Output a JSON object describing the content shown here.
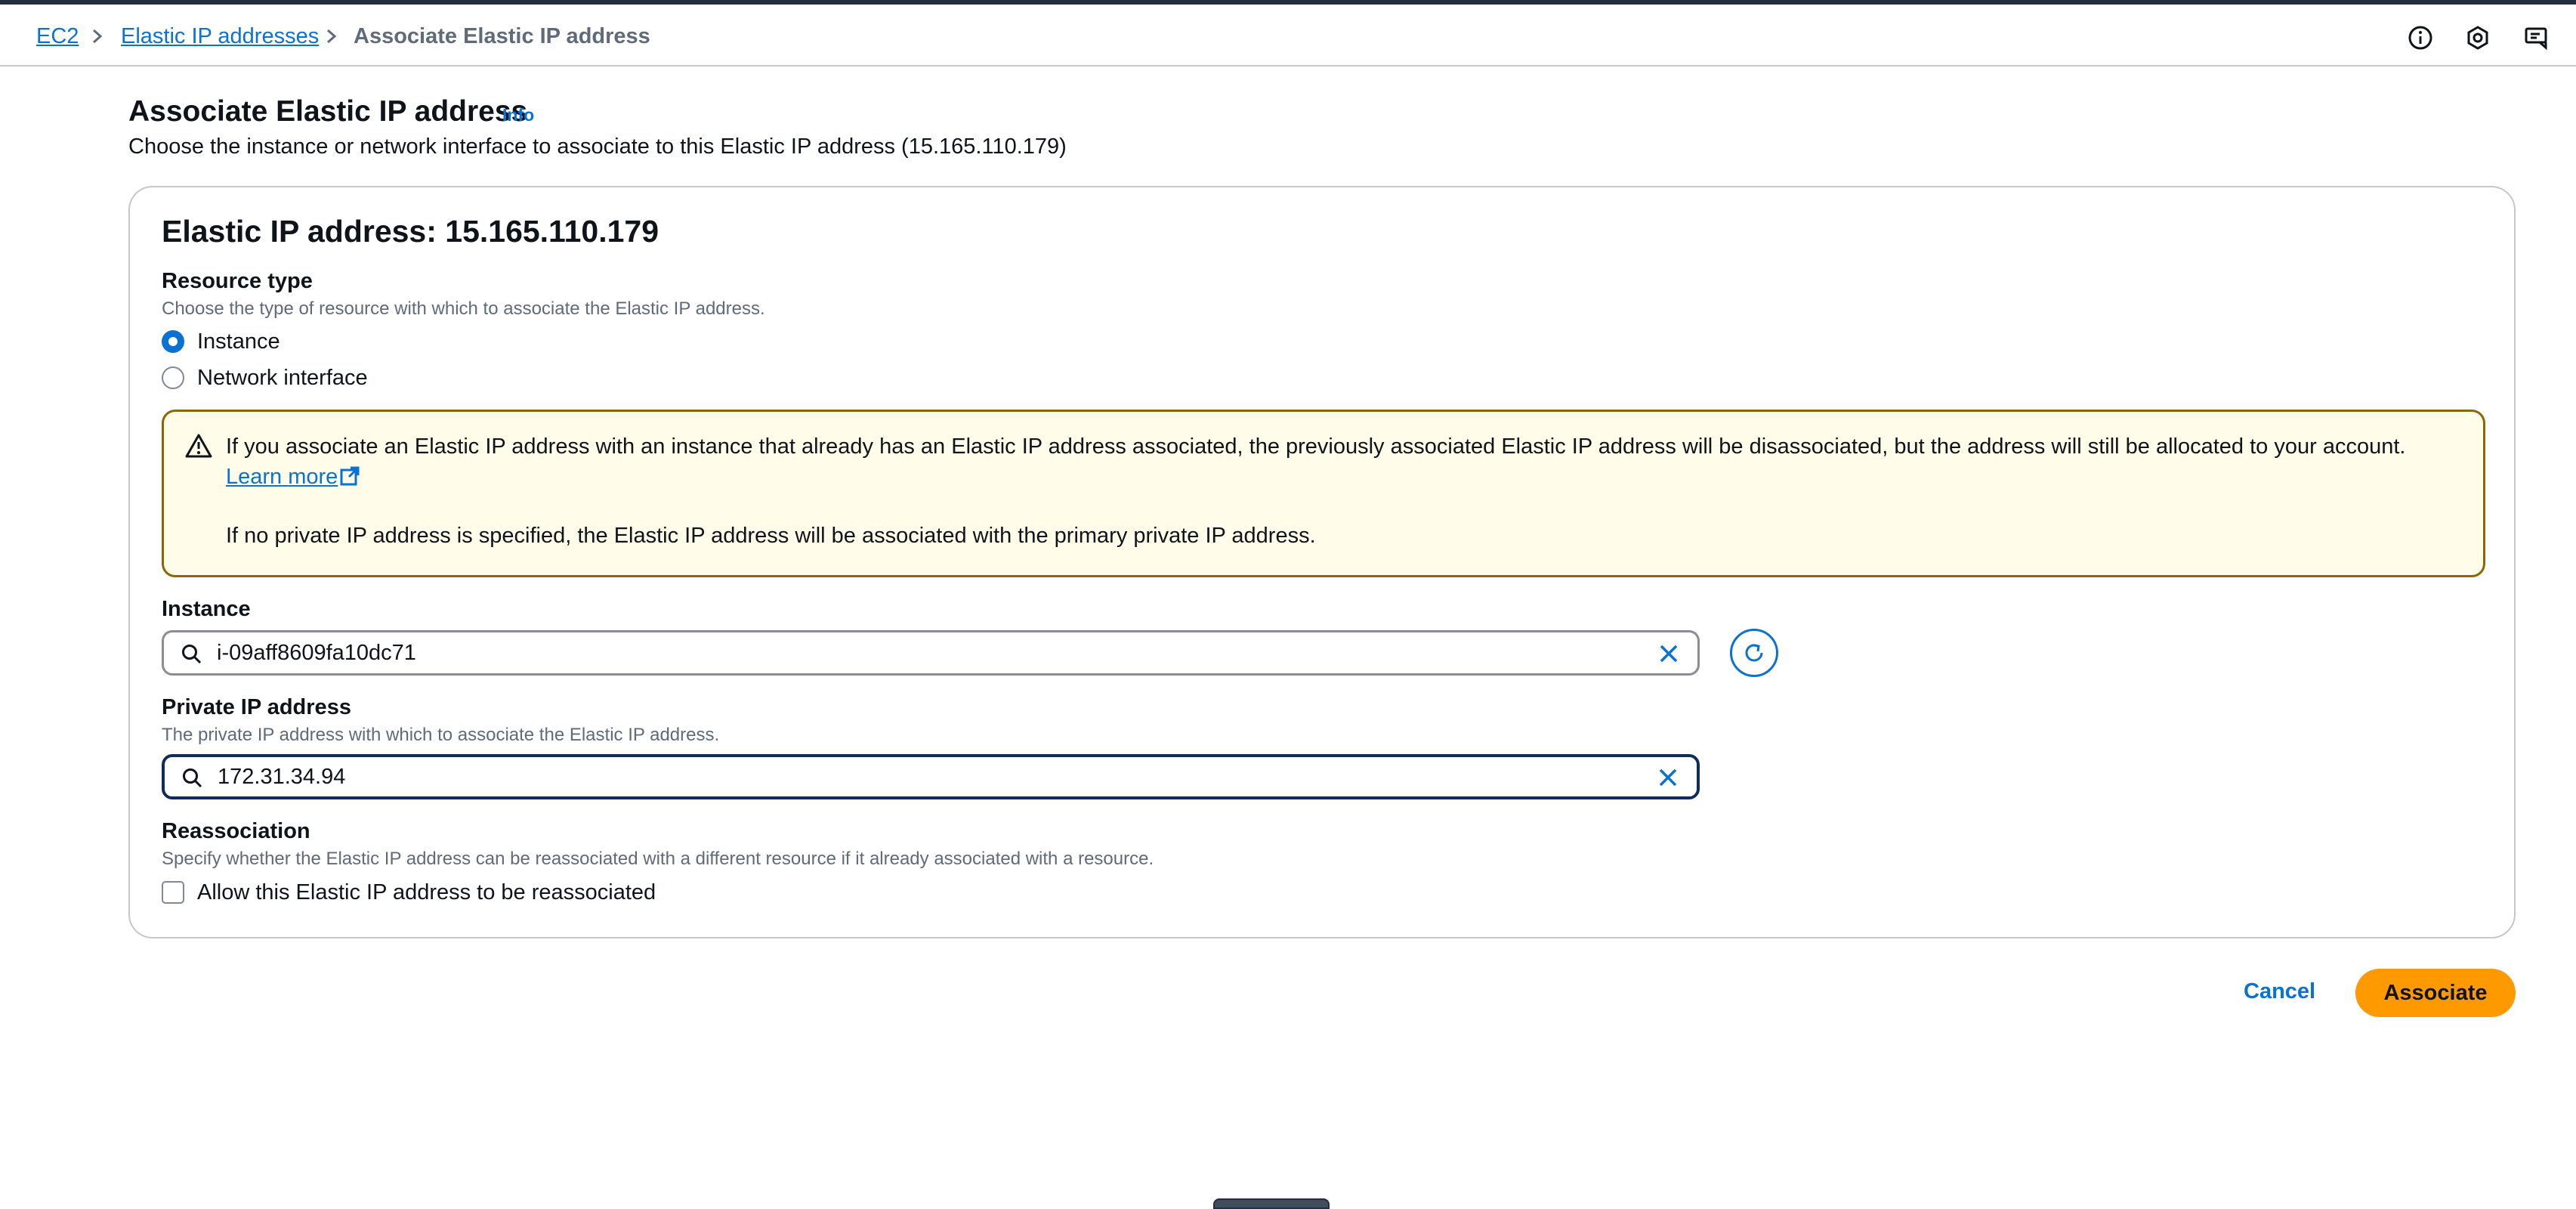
{
  "breadcrumb": {
    "items": [
      "EC2",
      "Elastic IP addresses"
    ],
    "current": "Associate Elastic IP address"
  },
  "header": {
    "title": "Associate Elastic IP address",
    "info": "Info",
    "description": "Choose the instance or network interface to associate to this Elastic IP address (15.165.110.179)"
  },
  "panel": {
    "title": "Elastic IP address: 15.165.110.179",
    "resource_type": {
      "label": "Resource type",
      "description": "Choose the type of resource with which to associate the Elastic IP address.",
      "options": [
        "Instance",
        "Network interface"
      ],
      "selected": "Instance"
    },
    "alert": {
      "text1": "If you associate an Elastic IP address with an instance that already has an Elastic IP address associated, the previously associated Elastic IP address will be disassociated, but the address will still be allocated to your account. ",
      "link_part1": "Learn",
      "link_part2": "more",
      "text2": "If no private IP address is specified, the Elastic IP address will be associated with the primary private IP address."
    },
    "instance": {
      "label": "Instance",
      "value": "i-09aff8609fa10dc71"
    },
    "private_ip": {
      "label": "Private IP address",
      "description": "The private IP address with which to associate the Elastic IP address.",
      "value": "172.31.34.94"
    },
    "reassociation": {
      "label": "Reassociation",
      "description": "Specify whether the Elastic IP address can be reassociated with a different resource if it already associated with a resource.",
      "checkbox_label": "Allow this Elastic IP address to be reassociated",
      "checked": false
    }
  },
  "actions": {
    "cancel": "Cancel",
    "associate": "Associate"
  },
  "colors": {
    "link": "#0972d3",
    "primary_button": "#ff9900",
    "warning_border": "#8d6605",
    "warning_bg": "#fffce9"
  },
  "icons": [
    "chevron-right-icon",
    "info-circle-icon",
    "notifications-icon",
    "feedback-icon",
    "warning-icon",
    "external-link-icon",
    "search-icon",
    "close-icon",
    "refresh-icon"
  ]
}
